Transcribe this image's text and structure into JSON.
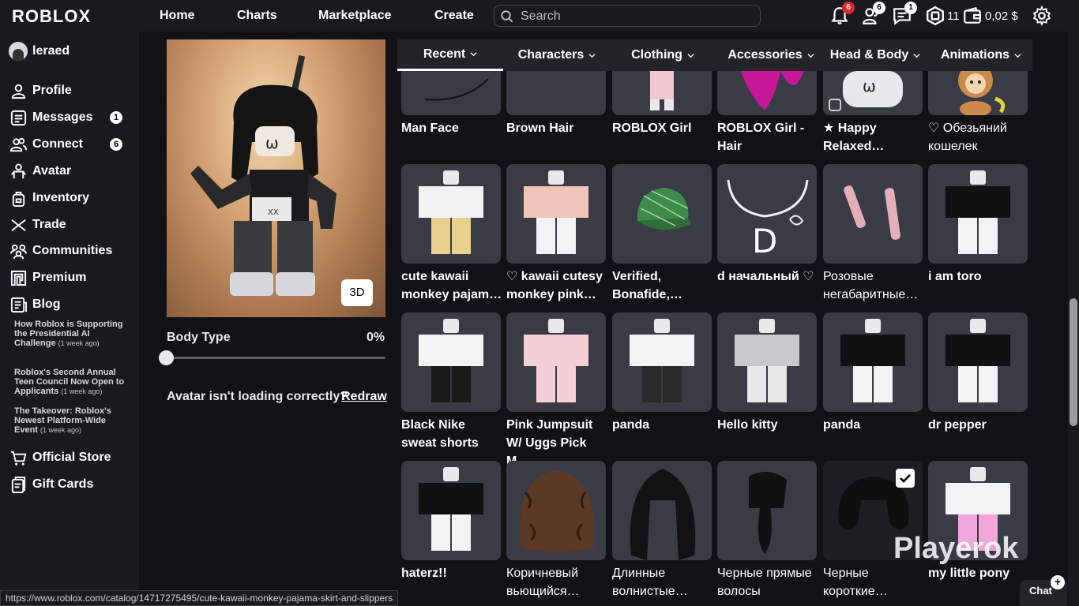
{
  "header": {
    "logo": "ROBLOX",
    "nav": [
      "Home",
      "Charts",
      "Marketplace",
      "Create"
    ],
    "search_placeholder": "Search",
    "notifications_badge": "6",
    "friends_badge": "6",
    "messages_badge": "1",
    "robux": "11",
    "balance": "0,02 $"
  },
  "sidebar": {
    "username": "leraed",
    "items": [
      {
        "label": "Profile",
        "icon": "user-icon"
      },
      {
        "label": "Messages",
        "icon": "messages-icon",
        "badge": "1"
      },
      {
        "label": "Connect",
        "icon": "friends-icon",
        "badge": "6"
      },
      {
        "label": "Avatar",
        "icon": "avatar-icon"
      },
      {
        "label": "Inventory",
        "icon": "inventory-icon"
      },
      {
        "label": "Trade",
        "icon": "trade-icon"
      },
      {
        "label": "Communities",
        "icon": "communities-icon"
      },
      {
        "label": "Premium",
        "icon": "premium-icon"
      },
      {
        "label": "Blog",
        "icon": "blog-icon"
      }
    ],
    "blog_posts": [
      {
        "title": "How Roblox is Supporting the Presidential AI Challenge",
        "ago": "(1 week ago)"
      },
      {
        "title": "Roblox's Second Annual Teen Council Now Open to Applicants",
        "ago": "(1 week ago)"
      },
      {
        "title": "The Takeover: Roblox's Newest Platform-Wide Event",
        "ago": "(1 week ago)"
      }
    ],
    "bottom_items": [
      {
        "label": "Official Store",
        "icon": "cart-icon"
      },
      {
        "label": "Gift Cards",
        "icon": "gift-card-icon"
      }
    ]
  },
  "avatar_panel": {
    "btn_3d": "3D",
    "body_type_label": "Body Type",
    "body_type_value": "0%",
    "body_type_fraction": 0,
    "redraw_text": "Avatar isn't loading correctly?",
    "redraw_link": "Redraw"
  },
  "tabs": [
    "Recent",
    "Characters",
    "Clothing",
    "Accessories",
    "Head & Body",
    "Animations"
  ],
  "active_tab": "Recent",
  "items": [
    {
      "name": "Man Face",
      "bold": true,
      "type": "face"
    },
    {
      "name": "Brown Hair",
      "bold": true,
      "type": "plain"
    },
    {
      "name": "ROBLOX Girl",
      "bold": true,
      "type": "pinkbody"
    },
    {
      "name": "ROBLOX Girl - Hair",
      "bold": true,
      "type": "pinkhair"
    },
    {
      "name": "★ Happy Relaxed…",
      "bold": true,
      "type": "happyface"
    },
    {
      "name": "♡ Обезьяний кошелек",
      "bold": false,
      "type": "monkey"
    },
    {
      "name": "cute kawaii monkey pajam…",
      "bold": true,
      "type": "shirt",
      "shirt": "#f2f2f2",
      "pants": "#e8d28e"
    },
    {
      "name": "♡ kawaii cutesy monkey pink…",
      "bold": true,
      "type": "shirt",
      "shirt": "#f1c4b8",
      "pants": "#f3f3f3"
    },
    {
      "name": "Verified, Bonafide,…",
      "bold": true,
      "type": "cap"
    },
    {
      "name": "d начальный ♡",
      "bold": true,
      "type": "necklace"
    },
    {
      "name": "Розовые негабаритные…",
      "bold": false,
      "type": "legwarmers"
    },
    {
      "name": "i am toro",
      "bold": true,
      "type": "shirt",
      "shirt": "#111111",
      "pants": "#f3f3f3"
    },
    {
      "name": "Black Nike sweat shorts",
      "bold": true,
      "type": "shirt",
      "shirt": "#f3f3f3",
      "pants": "#1a1a1a"
    },
    {
      "name": "Pink Jumpsuit W/ Uggs Pick M…",
      "bold": true,
      "type": "shirt",
      "shirt": "#f5cfd6",
      "pants": "#f5cfd6"
    },
    {
      "name": "panda",
      "bold": true,
      "type": "shirt",
      "shirt": "#f3f3f3",
      "pants": "#2a2a2a"
    },
    {
      "name": "Hello kitty",
      "bold": true,
      "type": "shirt",
      "shirt": "#c9c9cc",
      "pants": "#e8e8e8"
    },
    {
      "name": "panda",
      "bold": true,
      "type": "shirt",
      "shirt": "#111111",
      "pants": "#f3f3f3"
    },
    {
      "name": "dr pepper",
      "bold": true,
      "type": "shirt",
      "shirt": "#111111",
      "pants": "#f3f3f3"
    },
    {
      "name": "haterz!!",
      "bold": true,
      "type": "shirt",
      "shirt": "#111111",
      "pants": "#f3f3f3"
    },
    {
      "name": "Коричневый вьющийся…",
      "bold": false,
      "type": "curlyhair"
    },
    {
      "name": "Длинные волнистые…",
      "bold": false,
      "type": "wavyhair"
    },
    {
      "name": "Черные прямые волосы",
      "bold": false,
      "type": "ponytail"
    },
    {
      "name": "Черные короткие…",
      "bold": false,
      "type": "shorthair",
      "checked": true
    },
    {
      "name": "my little pony",
      "bold": true,
      "type": "shirt",
      "shirt": "#f3f3f3",
      "pants": "#f0a6d8"
    }
  ],
  "status_url": "https://www.roblox.com/catalog/14717275495/cute-kawaii-monkey-pajama-skirt-and-slippers",
  "watermark": "Playerok",
  "chat_label": "Chat",
  "chat_plus": "+"
}
